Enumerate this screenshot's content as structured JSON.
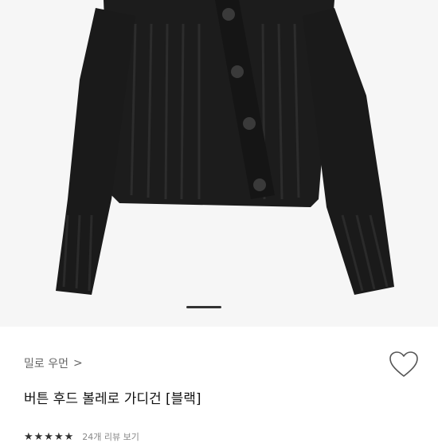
{
  "product": {
    "brand": "밀로 우먼",
    "brand_chevron": ">",
    "title": "버튼 후드 볼레로 가디건 [블랙]",
    "stars": "★★★★★",
    "reviews_text": "24개 리뷰 보기"
  },
  "icons": {
    "wishlist": "heart-outline-icon",
    "brand_link": "chevron-right-icon"
  },
  "colors": {
    "knit": "#1b1b1b",
    "indicator": "#333333"
  }
}
